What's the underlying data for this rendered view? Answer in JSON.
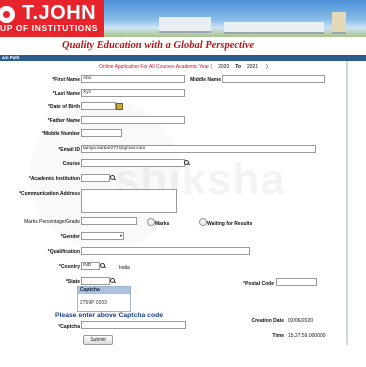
{
  "banner": {
    "brand": "T.JOHN",
    "group": "UP OF INSTITUTIONS",
    "tagline": "Quality Education with a Global Perspective",
    "path": "ain Path"
  },
  "watermark": "shiksha",
  "form": {
    "title_prefix": "Online Application For All Courses Academic Year (",
    "year_from": "2020",
    "year_to_label": "To",
    "year_to": "2021",
    "title_suffix": ")",
    "first_name": {
      "label": "*First Name",
      "value": "Abc"
    },
    "middle_name": {
      "label": "Middle Name",
      "value": ""
    },
    "last_name": {
      "label": "*Last Name",
      "value": "Xyz"
    },
    "dob": {
      "label": "*Date of Birth",
      "value": ""
    },
    "father_name": {
      "label": "*Father Name",
      "value": ""
    },
    "mobile": {
      "label": "*Mobile Number",
      "value": ""
    },
    "email": {
      "label": "*Email ID",
      "value": "taniya.sarkar277@gmail.com"
    },
    "course": {
      "label": "Course",
      "value": ""
    },
    "academic_institution": {
      "label": "*Academic Institution",
      "value": ""
    },
    "communication_address": {
      "label": "*Communication Address",
      "value": ""
    },
    "marks_pct": {
      "label": "Marks Percentage/Grade",
      "value": ""
    },
    "marks_radio": "Marks",
    "waiting_radio": "Waiting for Results",
    "gender": {
      "label": "*Gender",
      "value": ""
    },
    "qualification": {
      "label": "*Qualification",
      "value": ""
    },
    "country": {
      "label": "*Country",
      "value": "IND",
      "display": "India"
    },
    "state": {
      "label": "*State",
      "value": ""
    },
    "postal_code": {
      "label": "*Postal Code",
      "value": ""
    },
    "captcha_header": "Captcha",
    "captcha_code": "2759P 0203",
    "please_enter": "Please enter above Captcha code",
    "captcha": {
      "label": "*Captcha",
      "value": ""
    },
    "creation_date": {
      "label": "Creation Date",
      "value": "02/06/2020"
    },
    "time": {
      "label": "Time",
      "value": "15.27.59.000000"
    },
    "submit": "Submit"
  },
  "colors": {
    "brand_red": "#e7242b",
    "title_red": "#c0182a",
    "navy": "#1b3f86",
    "bar": "#2c5b8e"
  }
}
